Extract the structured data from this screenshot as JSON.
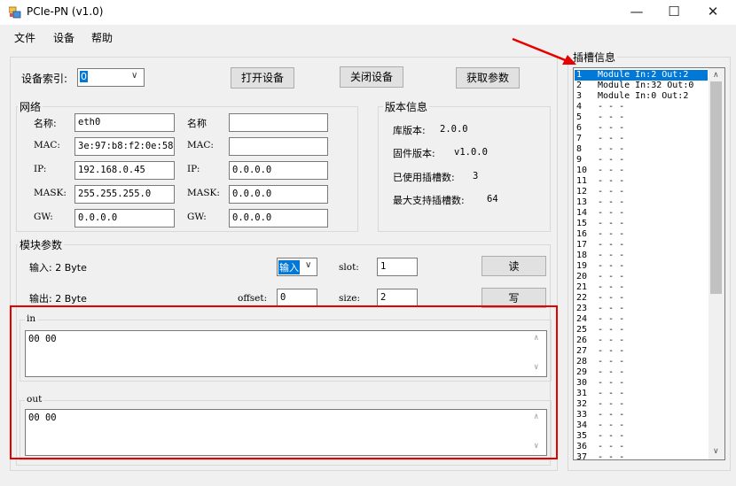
{
  "window": {
    "title": "PCIe-PN (v1.0)",
    "minimize": "—",
    "maximize": "☐",
    "close": "✕"
  },
  "menu": {
    "file": "文件",
    "device": "设备",
    "help": "帮助"
  },
  "device_bar": {
    "index_label": "设备索引:",
    "index_value": "0",
    "open_button": "打开设备",
    "close_button": "关闭设备",
    "get_params_button": "获取参数"
  },
  "network": {
    "title": "网络",
    "left": {
      "name_label": "名称:",
      "name_value": "eth0",
      "mac_label": "MAC:",
      "mac_value": "3e:97:b8:f2:0e:58",
      "ip_label": "IP:",
      "ip_value": "192.168.0.45",
      "mask_label": "MASK:",
      "mask_value": "255.255.255.0",
      "gw_label": "GW:",
      "gw_value": "0.0.0.0"
    },
    "right": {
      "name_label": "名称",
      "name_value": "",
      "mac_label": "MAC:",
      "mac_value": "",
      "ip_label": "IP:",
      "ip_value": "0.0.0.0",
      "mask_label": "MASK:",
      "mask_value": "0.0.0.0",
      "gw_label": "GW:",
      "gw_value": "0.0.0.0"
    }
  },
  "version": {
    "title": "版本信息",
    "lib_label": "库版本:",
    "lib_value": "2.0.0",
    "fw_label": "固件版本:",
    "fw_value": "v1.0.0",
    "used_label": "已使用插槽数:",
    "used_value": "3",
    "max_label": "最大支持插槽数:",
    "max_value": "64"
  },
  "module": {
    "title": "模块参数",
    "input_label": "输入: 2 Byte",
    "output_label": "输出: 2 Byte",
    "direction_value": "输入",
    "slot_label": "slot:",
    "slot_value": "1",
    "offset_label": "offset:",
    "offset_value": "0",
    "size_label": "size:",
    "size_value": "2",
    "read_button": "读",
    "write_button": "写",
    "in_title": "in",
    "in_value": "00 00",
    "out_title": "out",
    "out_value": "00 00"
  },
  "slots": {
    "title": "插槽信息",
    "selected_index": 0,
    "items": [
      {
        "num": "1",
        "text": "Module In:2 Out:2"
      },
      {
        "num": "2",
        "text": "Module In:32 Out:0"
      },
      {
        "num": "3",
        "text": "Module In:0 Out:2"
      },
      {
        "num": "4",
        "text": "- - -"
      },
      {
        "num": "5",
        "text": "- - -"
      },
      {
        "num": "6",
        "text": "- - -"
      },
      {
        "num": "7",
        "text": "- - -"
      },
      {
        "num": "8",
        "text": "- - -"
      },
      {
        "num": "9",
        "text": "- - -"
      },
      {
        "num": "10",
        "text": "- - -"
      },
      {
        "num": "11",
        "text": "- - -"
      },
      {
        "num": "12",
        "text": "- - -"
      },
      {
        "num": "13",
        "text": "- - -"
      },
      {
        "num": "14",
        "text": "- - -"
      },
      {
        "num": "15",
        "text": "- - -"
      },
      {
        "num": "16",
        "text": "- - -"
      },
      {
        "num": "17",
        "text": "- - -"
      },
      {
        "num": "18",
        "text": "- - -"
      },
      {
        "num": "19",
        "text": "- - -"
      },
      {
        "num": "20",
        "text": "- - -"
      },
      {
        "num": "21",
        "text": "- - -"
      },
      {
        "num": "22",
        "text": "- - -"
      },
      {
        "num": "23",
        "text": "- - -"
      },
      {
        "num": "24",
        "text": "- - -"
      },
      {
        "num": "25",
        "text": "- - -"
      },
      {
        "num": "26",
        "text": "- - -"
      },
      {
        "num": "27",
        "text": "- - -"
      },
      {
        "num": "28",
        "text": "- - -"
      },
      {
        "num": "29",
        "text": "- - -"
      },
      {
        "num": "30",
        "text": "- - -"
      },
      {
        "num": "31",
        "text": "- - -"
      },
      {
        "num": "32",
        "text": "- - -"
      },
      {
        "num": "33",
        "text": "- - -"
      },
      {
        "num": "34",
        "text": "- - -"
      },
      {
        "num": "35",
        "text": "- - -"
      },
      {
        "num": "36",
        "text": "- - -"
      },
      {
        "num": "37",
        "text": "- - -"
      }
    ]
  },
  "colors": {
    "selection": "#0078d7",
    "annotation_red": "#e60000"
  }
}
